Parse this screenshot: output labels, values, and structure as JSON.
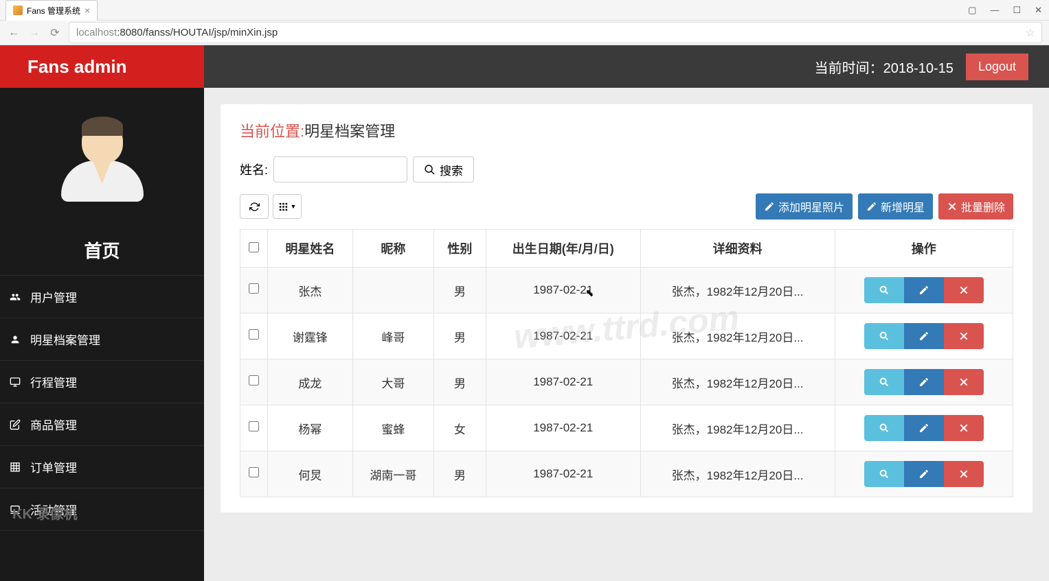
{
  "browser": {
    "tab_title": "Fans 管理系统",
    "url_host": "localhost",
    "url_path": ":8080/fanss/HOUTAI/jsp/minXin.jsp"
  },
  "header": {
    "logo": "Fans admin",
    "time_label": "当前时间：",
    "time_value": "2018-10-15",
    "logout": "Logout"
  },
  "sidebar": {
    "home": "首页",
    "items": [
      {
        "icon": "users",
        "label": "用户管理"
      },
      {
        "icon": "user",
        "label": "明星档案管理"
      },
      {
        "icon": "monitor",
        "label": "行程管理"
      },
      {
        "icon": "edit",
        "label": "商品管理"
      },
      {
        "icon": "grid",
        "label": "订单管理"
      },
      {
        "icon": "laptop",
        "label": "活动管理"
      }
    ]
  },
  "breadcrumb": {
    "label": "当前位置:",
    "value": "明星档案管理"
  },
  "search": {
    "label": "姓名:",
    "button": "搜索"
  },
  "toolbar": {
    "add_photo": "添加明星照片",
    "add_star": "新增明星",
    "batch_delete": "批量删除"
  },
  "table": {
    "headers": [
      "明星姓名",
      "昵称",
      "性别",
      "出生日期(年/月/日)",
      "详细资料",
      "操作"
    ],
    "rows": [
      {
        "name": "张杰",
        "nick": "",
        "gender": "男",
        "birth": "1987-02-21",
        "detail": "张杰，1982年12月20日..."
      },
      {
        "name": "谢霆锋",
        "nick": "峰哥",
        "gender": "男",
        "birth": "1987-02-21",
        "detail": "张杰，1982年12月20日..."
      },
      {
        "name": "成龙",
        "nick": "大哥",
        "gender": "男",
        "birth": "1987-02-21",
        "detail": "张杰，1982年12月20日..."
      },
      {
        "name": "杨幂",
        "nick": "蜜蜂",
        "gender": "女",
        "birth": "1987-02-21",
        "detail": "张杰，1982年12月20日..."
      },
      {
        "name": "何炅",
        "nick": "湖南一哥",
        "gender": "男",
        "birth": "1987-02-21",
        "detail": "张杰，1982年12月20日..."
      }
    ]
  },
  "watermark": "www.ttrd.com",
  "kk_recorder": "KK 录像机"
}
